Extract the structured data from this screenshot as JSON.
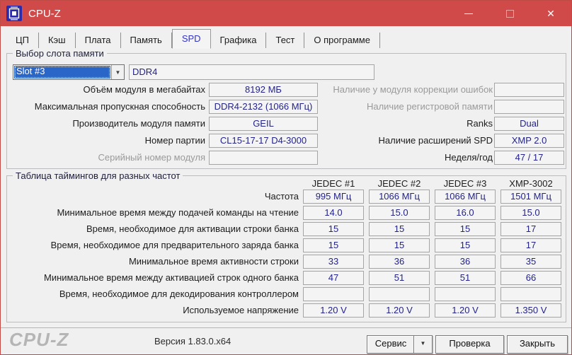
{
  "window": {
    "title": "CPU-Z",
    "icons": {
      "close": "✕",
      "combo_arrow": "▼",
      "dropdown_arrow": "▼"
    }
  },
  "tabs": [
    {
      "label": "ЦП"
    },
    {
      "label": "Кэш"
    },
    {
      "label": "Плата"
    },
    {
      "label": "Память"
    },
    {
      "label": "SPD",
      "active": true
    },
    {
      "label": "Графика"
    },
    {
      "label": "Тест"
    },
    {
      "label": "О программе"
    }
  ],
  "slot_group": {
    "title": "Выбор слота памяти",
    "slot_selected": "Slot #3",
    "memory_type": "DDR4",
    "left_fields": [
      {
        "label": "Объём модуля в мегабайтах",
        "value": "8192 МБ"
      },
      {
        "label": "Максимальная пропускная способность",
        "value": "DDR4-2132 (1066 МГц)"
      },
      {
        "label": "Производитель модуля памяти",
        "value": "GEIL"
      },
      {
        "label": "Номер партии",
        "value": "CL15-17-17 D4-3000"
      },
      {
        "label": "Серийный номер модуля",
        "value": "",
        "disabled": true
      }
    ],
    "right_fields": [
      {
        "label": "Наличие у модуля коррекции ошибок",
        "value": "",
        "disabled": true
      },
      {
        "label": "Наличие регистровой памяти",
        "value": "",
        "disabled": true
      },
      {
        "label": "Ranks",
        "value": "Dual"
      },
      {
        "label": "Наличие расширений SPD",
        "value": "XMP 2.0"
      },
      {
        "label": "Неделя/год",
        "value": "47 / 17"
      }
    ]
  },
  "timings_group": {
    "title": "Таблица таймингов для разных частот",
    "columns": [
      "JEDEC #1",
      "JEDEC #2",
      "JEDEC #3",
      "XMP-3002"
    ],
    "rows": [
      {
        "label": "Частота",
        "values": [
          "995 МГц",
          "1066 МГц",
          "1066 МГц",
          "1501 МГц"
        ]
      },
      {
        "label": "Минимальное время между подачей команды на чтение",
        "values": [
          "14.0",
          "15.0",
          "16.0",
          "15.0"
        ]
      },
      {
        "label": "Время, необходимое для активации строки банка",
        "values": [
          "15",
          "15",
          "15",
          "17"
        ]
      },
      {
        "label": "Время, необходимое для предварительного заряда банка",
        "values": [
          "15",
          "15",
          "15",
          "17"
        ]
      },
      {
        "label": "Минимальное время активности строки",
        "values": [
          "33",
          "36",
          "36",
          "35"
        ]
      },
      {
        "label": "Минимальное время между активацией строк одного банка",
        "values": [
          "47",
          "51",
          "51",
          "66"
        ]
      },
      {
        "label": "Время, необходимое для декодирования контроллером",
        "values": [
          "",
          "",
          "",
          ""
        ]
      },
      {
        "label": "Используемое напряжение",
        "values": [
          "1.20 V",
          "1.20 V",
          "1.20 V",
          "1.350 V"
        ]
      }
    ]
  },
  "footer": {
    "logo": "CPU-Z",
    "version": "Версия 1.83.0.x64",
    "service_button": "Сервис",
    "validate_button": "Проверка",
    "close_button": "Закрыть"
  },
  "colors": {
    "titlebar": "#d14a4a",
    "value_text": "#23238c",
    "selection_blue": "#2a65c8",
    "active_tab_text": "#3333cc"
  }
}
